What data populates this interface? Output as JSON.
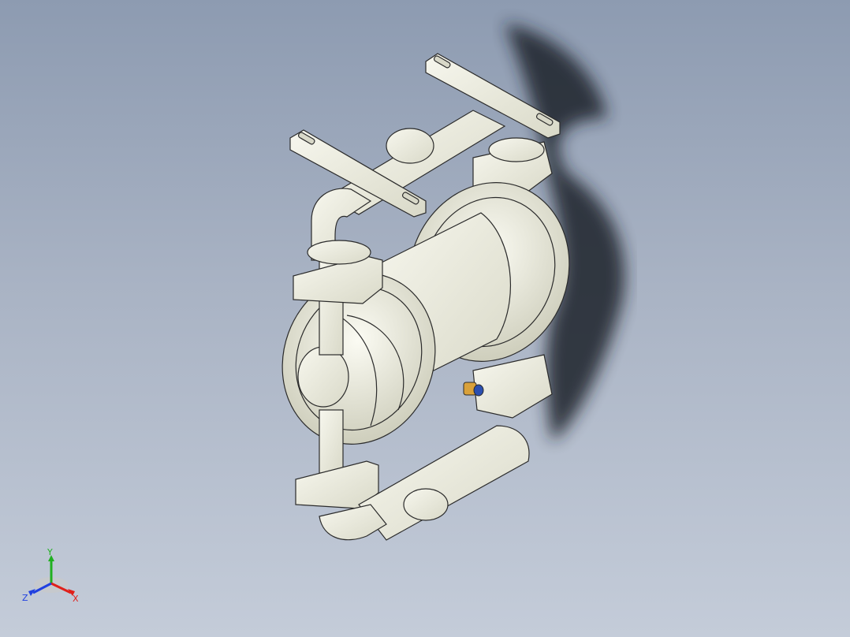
{
  "viewport": {
    "background_top": "#8d9bb1",
    "background_bottom": "#c4ccd9"
  },
  "model": {
    "part_color": "#efefe2",
    "edge_color": "#2b2b2b",
    "shadow_color": "#1f232b",
    "fitting_color": "#d9a13a",
    "fitting_ring_color": "#2b4fb0"
  },
  "triad": {
    "x_label": "X",
    "y_label": "Y",
    "z_label": "Z",
    "x_color": "#e0201a",
    "y_color": "#20b020",
    "z_color": "#2040e0"
  }
}
